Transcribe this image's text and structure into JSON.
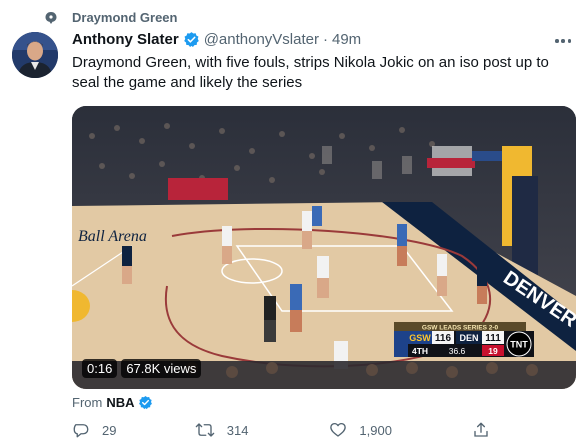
{
  "topic": {
    "label": "Draymond Green",
    "icon": "topic-bubble-icon"
  },
  "author": {
    "name": "Anthony Slater",
    "handle": "@anthonyVslater",
    "separator": "·",
    "time": "49m",
    "verified": true
  },
  "tweet": {
    "text": "Draymond Green, with five fouls, strips Nikola Jokic on an iso post up to seal the game and likely the series"
  },
  "video": {
    "duration": "0:16",
    "views": "67.8K views",
    "scoreboard": {
      "banner": "GSW LEADS SERIES 2-0",
      "home_team": "GSW",
      "home_score": "116",
      "away_team": "DEN",
      "away_score": "111",
      "quarter": "4TH",
      "clock": "36.6",
      "shot_clock": "19",
      "network": "TNT"
    },
    "arena_banner": "DENVER NUGGETS",
    "arena_logo": "Ball Arena"
  },
  "source": {
    "prefix": "From",
    "name": "NBA"
  },
  "actions": {
    "replies": "29",
    "retweets": "314",
    "likes": "1,900"
  },
  "colors": {
    "verified": "#1d9bf0",
    "text": "#0f1419",
    "secondary": "#536471",
    "court": "#e2c9a4",
    "nuggets_blue": "#0e2240"
  }
}
